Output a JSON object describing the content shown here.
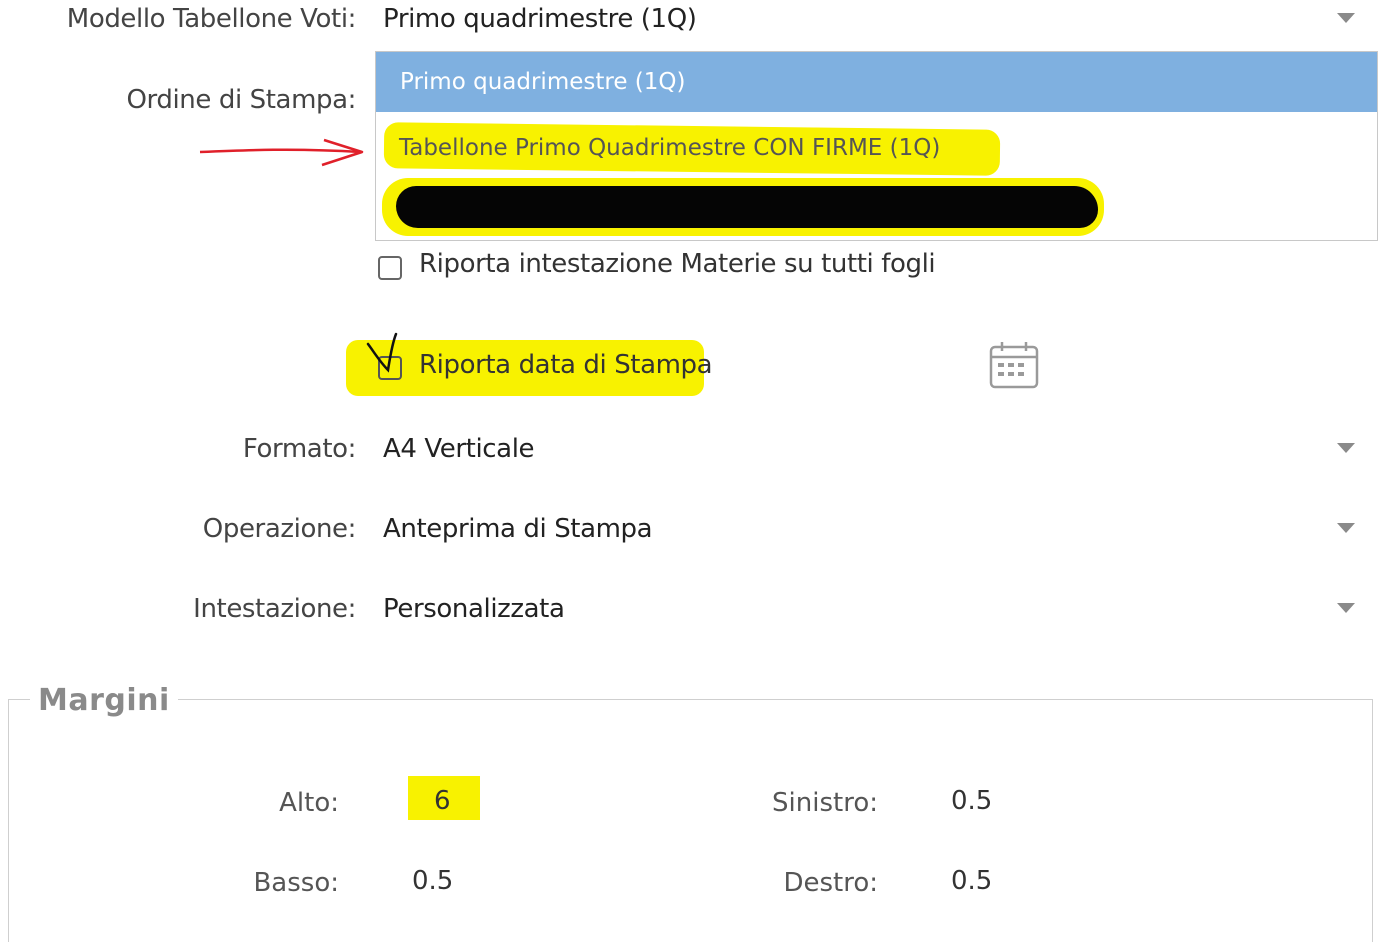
{
  "form": {
    "modello_label": "Modello Tabellone Voti:",
    "modello_value": "Primo quadrimestre (1Q)",
    "ordine_label": "Ordine di Stampa:",
    "dropdown_options": [
      "Primo quadrimestre (1Q)",
      "Tabellone Primo Quadrimestre CON FIRME (1Q)"
    ],
    "riporta_materie_label": "Riporta intestazione Materie su tutti fogli",
    "riporta_data_label": "Riporta data di Stampa",
    "formato_label": "Formato:",
    "formato_value": "A4 Verticale",
    "operazione_label": "Operazione:",
    "operazione_value": "Anteprima di Stampa",
    "intestazione_label": "Intestazione:",
    "intestazione_value": "Personalizzata"
  },
  "margini": {
    "title": "Margini",
    "alto_label": "Alto:",
    "alto_value": "6",
    "basso_label": "Basso:",
    "basso_value": "0.5",
    "sinistro_label": "Sinistro:",
    "sinistro_value": "0.5",
    "destro_label": "Destro:",
    "destro_value": "0.5"
  },
  "icons": {
    "caret": "chevron-down-icon",
    "calendar": "calendar-icon",
    "arrow": "red-arrow-annotation",
    "checkmark": "handwritten-check-annotation"
  },
  "colors": {
    "selected_option_bg": "#7fb0e0",
    "highlight": "#f8f200",
    "annotation_red": "#e0202a"
  }
}
